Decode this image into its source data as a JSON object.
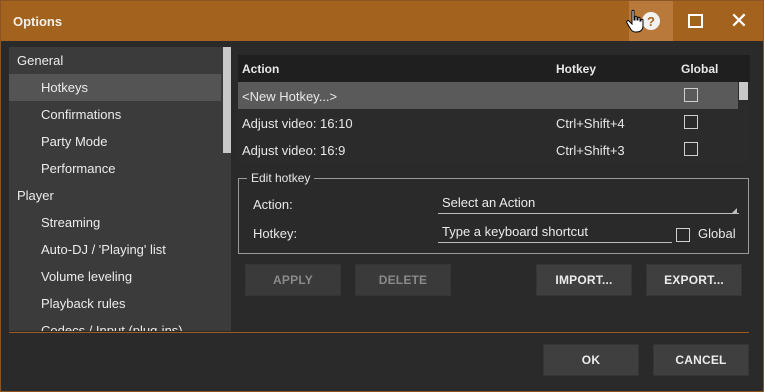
{
  "window": {
    "title": "Options"
  },
  "titlebar": {
    "help_label": "?",
    "close_glyph": "✕"
  },
  "sidebar": {
    "items": [
      {
        "label": "General",
        "type": "group"
      },
      {
        "label": "Hotkeys",
        "type": "child",
        "selected": true
      },
      {
        "label": "Confirmations",
        "type": "child"
      },
      {
        "label": "Party Mode",
        "type": "child"
      },
      {
        "label": "Performance",
        "type": "child"
      },
      {
        "label": "Player",
        "type": "group"
      },
      {
        "label": "Streaming",
        "type": "child"
      },
      {
        "label": "Auto-DJ / 'Playing' list",
        "type": "child"
      },
      {
        "label": "Volume leveling",
        "type": "child"
      },
      {
        "label": "Playback rules",
        "type": "child"
      },
      {
        "label": "Codecs / Input (plug-ins)",
        "type": "child"
      }
    ]
  },
  "hotkeys_table": {
    "columns": {
      "action": "Action",
      "hotkey": "Hotkey",
      "global": "Global"
    },
    "rows": [
      {
        "action": "<New Hotkey...>",
        "hotkey": "",
        "global": false,
        "selected": true
      },
      {
        "action": "Adjust video: 16:10",
        "hotkey": "Ctrl+Shift+4",
        "global": false
      },
      {
        "action": "Adjust video: 16:9",
        "hotkey": "Ctrl+Shift+3",
        "global": false
      }
    ]
  },
  "edit_hotkey": {
    "legend": "Edit hotkey",
    "action_label": "Action:",
    "action_value": "Select an Action",
    "hotkey_label": "Hotkey:",
    "hotkey_value": "Type a keyboard shortcut",
    "global_label": "Global"
  },
  "buttons": {
    "apply": "APPLY",
    "delete": "DELETE",
    "import": "IMPORT...",
    "export": "EXPORT...",
    "ok": "OK",
    "cancel": "CANCEL"
  },
  "colors": {
    "titlebar": "#a3631f",
    "window_bg": "#2a2a2a",
    "sidebar_bg": "#3b3b3b",
    "selection": "#545454",
    "button_bg": "#3f3f3f"
  }
}
